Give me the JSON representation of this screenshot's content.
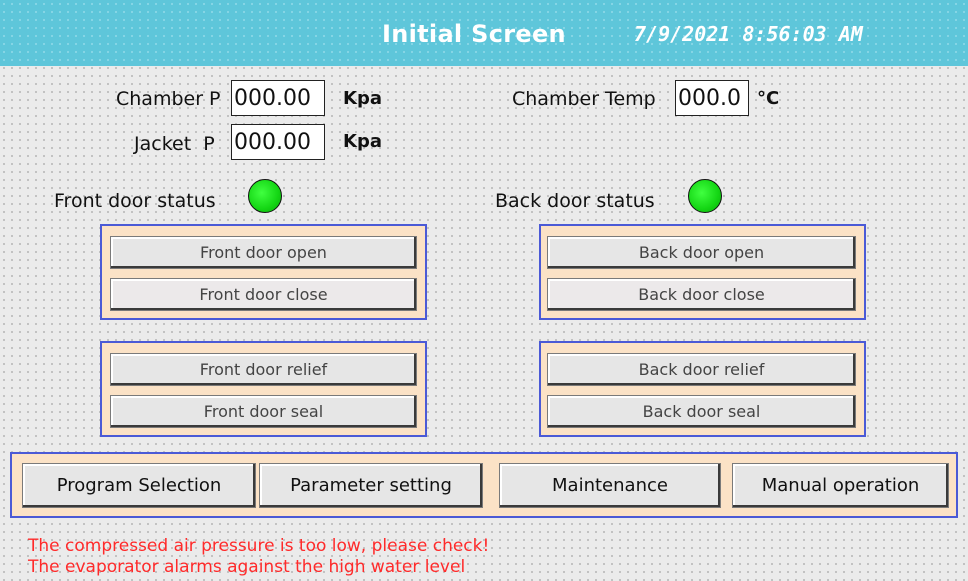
{
  "header": {
    "title": "Initial Screen",
    "datetime": "7/9/2021 8:56:03 AM",
    "bg_color": "#5ec6da"
  },
  "readings": {
    "chamber_p": {
      "label": "Chamber P",
      "value": "000.00",
      "unit": "Kpa"
    },
    "jacket_p": {
      "label": "Jacket  P",
      "value": "000.00",
      "unit": "Kpa"
    },
    "chamber_temp": {
      "label": "Chamber Temp",
      "value": "000.0",
      "unit": "°C"
    }
  },
  "status": {
    "front_door": {
      "label": "Front door status",
      "color": "#14d614"
    },
    "back_door": {
      "label": "Back door status",
      "color": "#14d614"
    }
  },
  "front_controls": {
    "open": "Front door open",
    "close": "Front door close",
    "relief": "Front door relief",
    "seal": "Front door seal"
  },
  "back_controls": {
    "open": "Back door open",
    "close": "Back door close",
    "relief": "Back door relief",
    "seal": "Back door seal"
  },
  "nav": {
    "program_selection": "Program Selection",
    "parameter_setting": "Parameter setting",
    "maintenance": "Maintenance",
    "manual_operation": "Manual operation"
  },
  "alarms": [
    "The compressed air pressure is too low, please check!",
    "The evaporator alarms against the high water level"
  ],
  "colors": {
    "group_fill": "#fbe2c6",
    "group_border": "#4b5ad6",
    "alarm_text": "#ff2a2a"
  }
}
